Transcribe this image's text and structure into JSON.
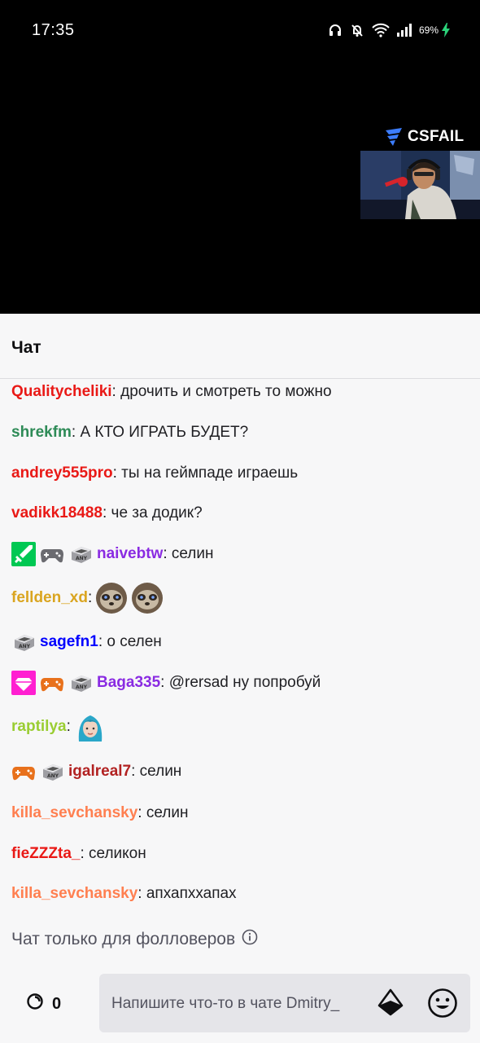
{
  "status_bar": {
    "time": "17:35",
    "battery": "69%",
    "icons": [
      "headphones-icon",
      "bell-off-icon",
      "wifi-icon",
      "signal-icon",
      "battery-charging-icon"
    ]
  },
  "video": {
    "sponsor_logo": "CSFAIL"
  },
  "chat": {
    "title": "Чат",
    "messages": [
      {
        "user": "Qualitycheliki",
        "text": ": дрочить и смотреть то можно",
        "color": "#e91916"
      },
      {
        "user": "shrekfm",
        "text": ": А КТО ИГРАТЬ БУДЕТ?",
        "color": "#2e8b57"
      },
      {
        "user": "andrey555pro",
        "text": ": ты на геймпаде играешь",
        "color": "#e91916"
      },
      {
        "user": "vadikk18488",
        "text": ": че за додик?",
        "color": "#e91916"
      },
      {
        "user": "naivebtw",
        "text": ": селин",
        "color": "#8a2be2",
        "badges": [
          "sword-badge",
          "gamepad-badge",
          "any-key-badge"
        ]
      },
      {
        "user": "fellden_xd",
        "text": ":",
        "color": "#daa520",
        "emotes": [
          "sloth-emote",
          "sloth-emote"
        ]
      },
      {
        "user": "sagefn1",
        "text": ": о селен",
        "color": "#0000ff",
        "badges": [
          "any-key-badge"
        ]
      },
      {
        "user": "Baga335",
        "text": ": @rersad ну попробуй",
        "color": "#8a2be2",
        "badges": [
          "gem-badge",
          "orange-gamepad-badge",
          "any-key-badge"
        ]
      },
      {
        "user": "raptilya",
        "text": ":",
        "color": "#9acd32",
        "emotes": [
          "blue-hair-emote"
        ]
      },
      {
        "user": "igalreal7",
        "text": ": селин",
        "color": "#b22222",
        "badges": [
          "orange-gamepad-badge",
          "any-key-badge"
        ]
      },
      {
        "user": "killa_sevchansky",
        "text": ": селин",
        "color": "#ff7f50"
      },
      {
        "user": "fieZZZta_",
        "text": ": селикон",
        "color": "#e91916"
      },
      {
        "user": "killa_sevchansky",
        "text": ": апхапххапах",
        "color": "#ff7f50"
      }
    ],
    "followers_only": "Чат только для фолловеров",
    "points": "0",
    "input_placeholder": "Напишите что-то в чате Dmitry_"
  },
  "colors": {
    "background": "#f7f7f8",
    "video_background": "#000000",
    "input_background": "#e5e5e9"
  }
}
